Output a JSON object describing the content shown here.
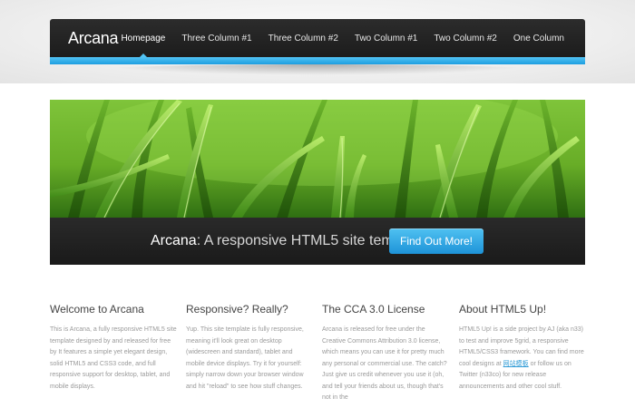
{
  "header": {
    "logo": "Arcana",
    "nav": [
      {
        "label": "Homepage",
        "active": true
      },
      {
        "label": "Three Column #1",
        "active": false
      },
      {
        "label": "Three Column #2",
        "active": false
      },
      {
        "label": "Two Column #1",
        "active": false
      },
      {
        "label": "Two Column #2",
        "active": false
      },
      {
        "label": "One Column",
        "active": false
      }
    ]
  },
  "banner": {
    "brand": "Arcana",
    "tagline": ": A responsive HTML5 site template",
    "button_label": "Find Out More!"
  },
  "columns": [
    {
      "title": "Welcome to Arcana",
      "text": "This is Arcana, a fully responsive HTML5 site template designed by and released for free by It features a simple yet elegant design, solid HTML5 and CSS3 code, and full responsive support for desktop, tablet, and mobile displays."
    },
    {
      "title": "Responsive? Really?",
      "text": "Yup. This site template is fully responsive, meaning it'll look great on desktop (widescreen and standard), tablet and mobile device displays. Try it for yourself: simply narrow down your browser window and hit \"reload\" to see how stuff changes."
    },
    {
      "title": "The CCA 3.0 License",
      "text": "Arcana is released for free under the Creative Commons Attribution 3.0 license, which means you can use it for pretty much any personal or commercial use. The catch? Just give us credit whenever you use it (oh, and tell your friends about us, though that's not in the"
    },
    {
      "title": "About HTML5 Up!",
      "text_before": "HTML5 Up! is a side project by AJ (aka n33) to test and improve 5grid, a responsive HTML5/CSS3 framework. You can find more cool designs at ",
      "link": "网站模板",
      "text_after": " or follow us on Twitter (n33co) for new release announcements and other cool stuff."
    }
  ],
  "colors": {
    "nav_bg": "#222222",
    "accent_blue": "#1d9ee0",
    "banner_green": "#6fb02c",
    "body_text": "#9a9a9a"
  }
}
